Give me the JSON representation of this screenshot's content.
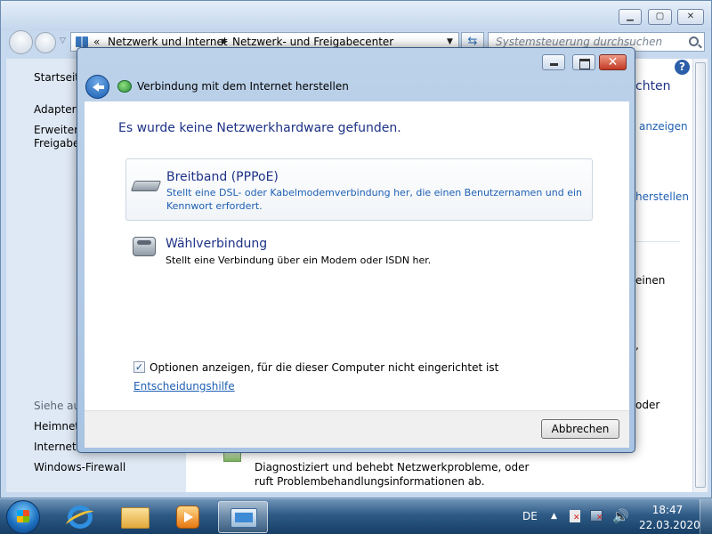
{
  "explorer": {
    "breadcrumb": {
      "overflow": "«",
      "items": [
        "Netzwerk und Internet",
        "Netzwerk- und Freigabecenter"
      ],
      "separator": "▶"
    },
    "search_placeholder": "Systemsteuerung durchsuchen",
    "sidebar": {
      "home": "Startseite",
      "adapter": "Adaptere",
      "advanced_line1": "Erweiterte",
      "advanced_line2": "Freigabee",
      "see_also": "Siehe auc",
      "homegroup": "Heimnetz",
      "internet_options": "Interneto",
      "firewall": "Windows-Firewall"
    },
    "main_fragments": {
      "title_tail": "chten",
      "show_tail": "anzeigen",
      "create_tail": "herstellen",
      "join_tail": "einen",
      "comma": ",",
      "or_tail": "oder",
      "diagnose_text": "Diagnostiziert und behebt Netzwerkprobleme, oder ruft Problembehandlungsinformationen ab."
    },
    "help": "?"
  },
  "dialog": {
    "title": "Verbindung mit dem Internet herstellen",
    "heading": "Es wurde keine Netzwerkhardware gefunden.",
    "options": [
      {
        "title": "Breitband (PPPoE)",
        "description": "Stellt eine DSL- oder Kabelmodemverbindung her, die einen Benutzernamen und ein Kennwort erfordert.",
        "icon": "modem-icon"
      },
      {
        "title": "Wählverbindung",
        "description": "Stellt eine Verbindung über ein Modem oder ISDN her.",
        "icon": "phone-icon"
      }
    ],
    "show_options_label": "Optionen anzeigen, für die dieser Computer nicht eingerichtet ist",
    "show_options_checked": true,
    "check_mark": "✓",
    "help_link": "Entscheidungshilfe",
    "cancel": "Abbrechen",
    "close_glyph": "✕"
  },
  "taskbar": {
    "language": "DE",
    "tray_arrow": "▲",
    "volume_glyph": "🔊",
    "time": "18:47",
    "date": "22.03.2020",
    "pinned": [
      "ie-icon",
      "folder-icon",
      "media-icon",
      "network-center-icon"
    ]
  }
}
